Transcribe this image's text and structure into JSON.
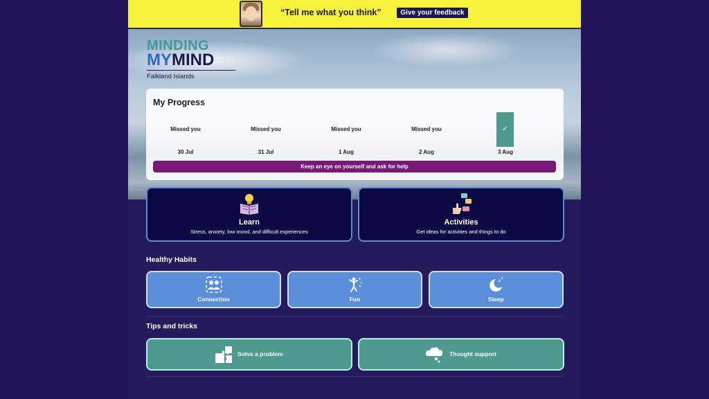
{
  "banner": {
    "quote": "“Tell me what you think”",
    "feedback_button": "Give your feedback"
  },
  "logo": {
    "line1": "MINDING",
    "line2_a": "MY",
    "line2_b": "MIND",
    "line3": "Falkland Islands"
  },
  "progress": {
    "title": "My Progress",
    "days": [
      {
        "status": "Missed you",
        "date": "30 Jul",
        "checked": false
      },
      {
        "status": "Missed you",
        "date": "31 Jul",
        "checked": false
      },
      {
        "status": "Missed you",
        "date": "1 Aug",
        "checked": false
      },
      {
        "status": "Missed you",
        "date": "2 Aug",
        "checked": false
      },
      {
        "status": "",
        "date": "3 Aug",
        "checked": true
      }
    ],
    "help_bar": "Keep an eye on yourself and ask for help"
  },
  "cards": {
    "learn": {
      "title": "Learn",
      "desc": "Stress, anxiety, low mood, and difficult experiences",
      "icon": "book-lightbulb-icon"
    },
    "activities": {
      "title": "Activities",
      "desc": "Get ideas for activities and things to do",
      "icon": "activities-icon"
    }
  },
  "healthy_habits": {
    "title": "Healthy Habits",
    "items": [
      {
        "label": "Connection",
        "icon": "connection-icon"
      },
      {
        "label": "Fun",
        "icon": "fun-icon"
      },
      {
        "label": "Sleep",
        "icon": "sleep-icon"
      }
    ]
  },
  "tips": {
    "title": "Tips and tricks",
    "items": [
      {
        "label": "Solve a problem",
        "icon": "puzzle-icon"
      },
      {
        "label": "Thought support",
        "icon": "thought-cloud-icon"
      }
    ]
  },
  "colors": {
    "background": "#221458",
    "banner": "#f7f33c",
    "card_dark": "#0d0a43",
    "card_border": "#5d8be0",
    "habit": "#5b8ed9",
    "tip": "#4e9a8f",
    "help_bar": "#7a1678"
  }
}
